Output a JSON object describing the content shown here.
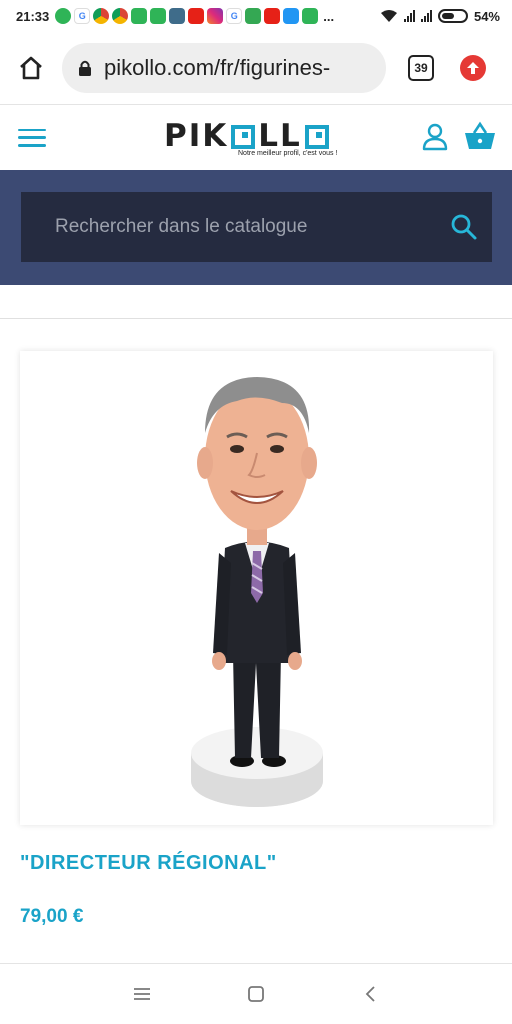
{
  "status_bar": {
    "time": "21:33",
    "battery": "54%",
    "battery_level": 0.54,
    "notification_icons": [
      "whatsapp-icon",
      "google-icon",
      "chrome-icon",
      "chrome-icon",
      "phone-icon",
      "messages-icon",
      "settings-icon",
      "youtube-icon",
      "instagram-icon",
      "google-icon",
      "puzzle-icon",
      "youtube-icon",
      "upload-icon",
      "phone-icon"
    ],
    "more": "..."
  },
  "browser": {
    "url": "pikollo.com/fr/figurines-",
    "tab_count": "39",
    "accent_color": "#e53935"
  },
  "site_header": {
    "logo_text_left": "PIK",
    "logo_text_mid": "LL",
    "logo_tagline": "Notre meilleur profil, c'est vous !",
    "accent_color": "#1aa3c8"
  },
  "search": {
    "placeholder": "Rechercher dans le catalogue"
  },
  "product": {
    "title": "\"DIRECTEUR RÉGIONAL\"",
    "price": "79,00 €"
  },
  "nav": {
    "icons": [
      "recent-apps-icon",
      "home-icon",
      "back-icon"
    ]
  }
}
